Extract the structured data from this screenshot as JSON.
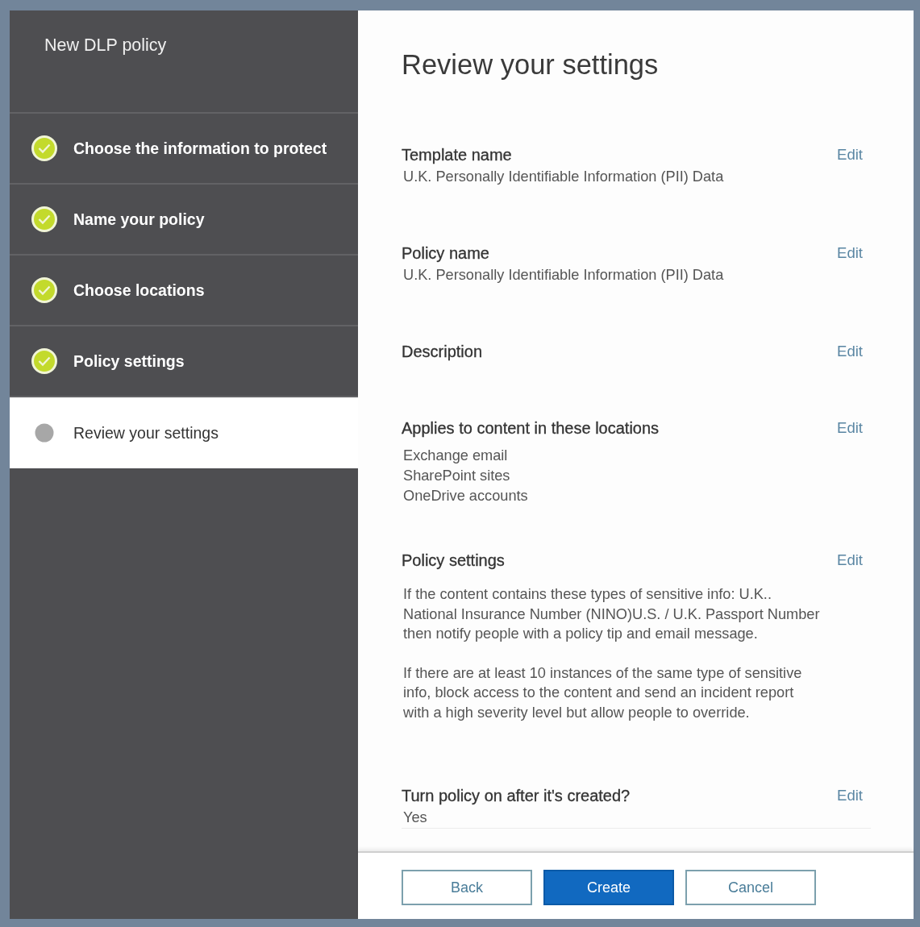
{
  "wizard": {
    "title": "New DLP policy",
    "steps": [
      {
        "label": "Choose the information to protect",
        "completed": true,
        "selected": false
      },
      {
        "label": "Name your policy",
        "completed": true,
        "selected": false
      },
      {
        "label": "Choose locations",
        "completed": true,
        "selected": false
      },
      {
        "label": "Policy settings",
        "completed": true,
        "selected": false
      },
      {
        "label": "Review your settings",
        "completed": false,
        "selected": true
      }
    ]
  },
  "review": {
    "title": "Review your settings",
    "sections": [
      {
        "label": "Template name",
        "action": "Edit",
        "kind": "lines",
        "values": [
          "U.K. Personally Identifiable Information (PII) Data"
        ]
      },
      {
        "label": "Policy name",
        "action": "Edit",
        "kind": "lines",
        "values": [
          "U.K. Personally Identifiable Information (PII) Data"
        ]
      },
      {
        "label": "Description",
        "action": "Edit",
        "kind": "lines"
      },
      {
        "label": "Applies to content in these locations",
        "action": "Edit",
        "kind": "list",
        "values": [
          "Exchange email",
          "SharePoint sites",
          "OneDrive accounts"
        ]
      },
      {
        "label": "Policy settings",
        "action": "Edit",
        "kind": "paragraphs",
        "values": [
          "If the content contains these types of sensitive info: U.K.. National Insurance Number (NINO)U.S. / U.K. Passport Number then notify people with a policy tip and email message.",
          "If there are at least 10 instances of the same type of sensitive info, block access to the content and send an incident report with a high severity level but allow people to override."
        ]
      },
      {
        "label": "Turn policy on after it's created?",
        "action": "Edit",
        "kind": "lines",
        "values": [
          "Yes"
        ]
      }
    ]
  },
  "buttons": [
    {
      "label": "Back",
      "kind": "secondary"
    },
    {
      "label": "Create",
      "kind": "primary"
    },
    {
      "label": "Cancel",
      "kind": "secondary"
    }
  ]
}
